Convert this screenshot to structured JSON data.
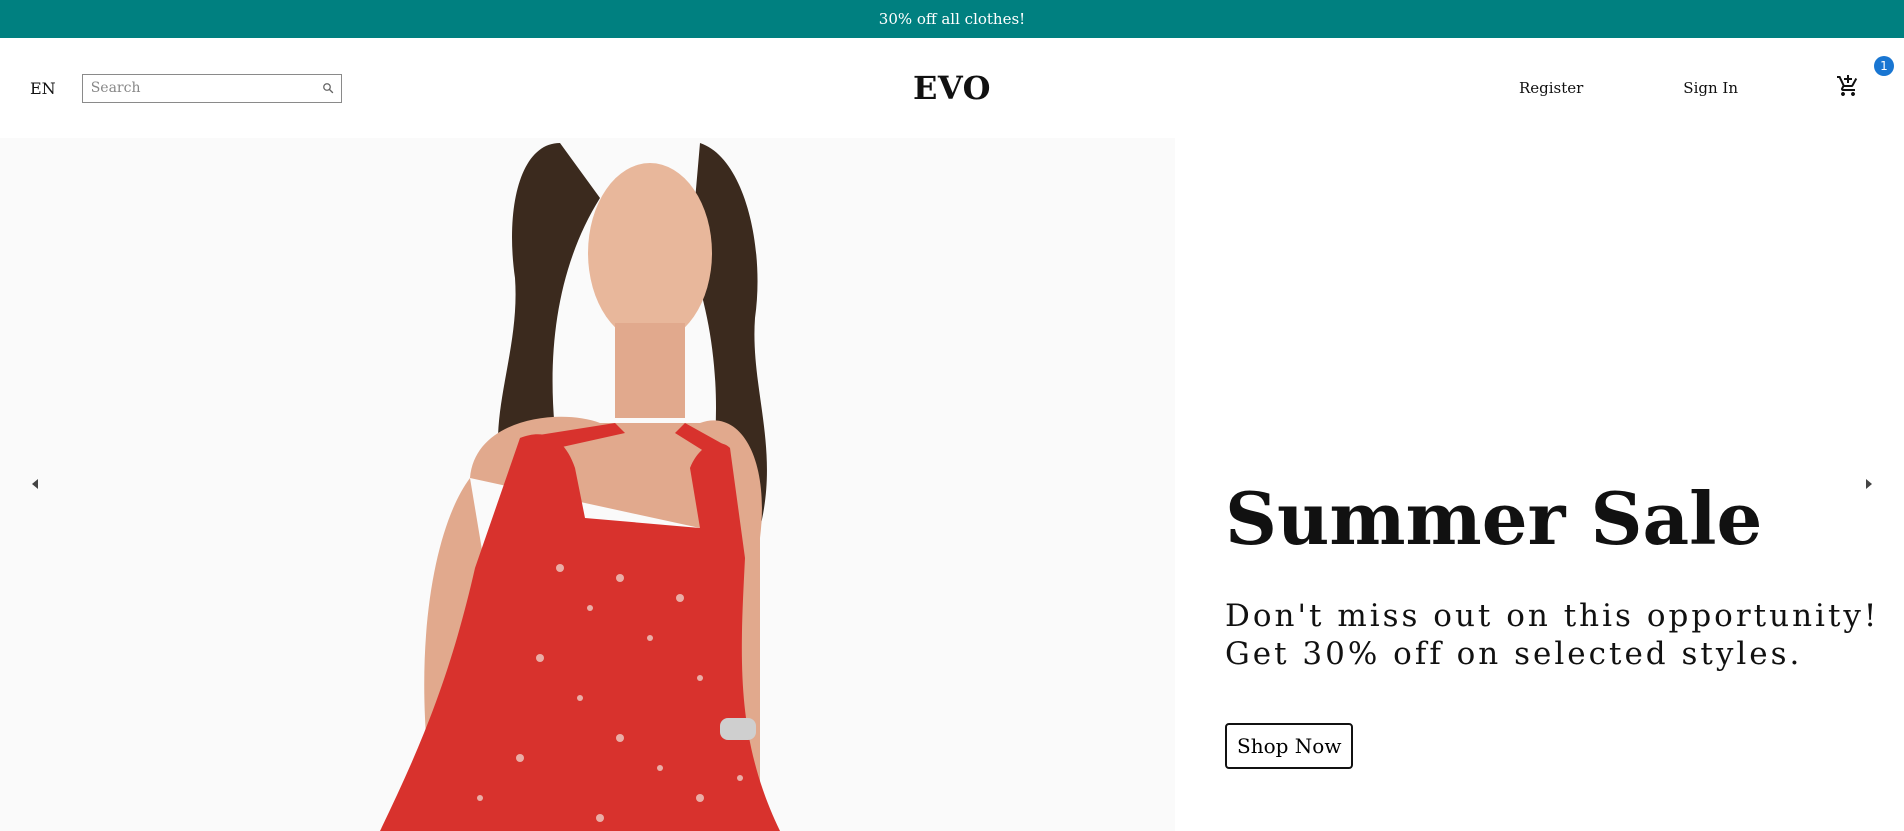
{
  "announcement": {
    "text": "30% off all clothes!"
  },
  "header": {
    "language": "EN",
    "search": {
      "placeholder": "Search",
      "value": ""
    },
    "logo": "EVO",
    "menu": {
      "register": "Register",
      "sign_in": "Sign In"
    },
    "cart": {
      "count": "1"
    }
  },
  "slider": {
    "title": "Summer Sale",
    "description_line1": "Don't miss out on this opportunity!",
    "description_line2": "Get 30% off on selected styles.",
    "button_label": "Shop Now",
    "image_label": "model in red floral halter dress"
  },
  "colors": {
    "announcement_bg": "#008080",
    "badge": "#1976d2",
    "dress": "#d8322d",
    "slide_bg": "#f5f5f5"
  },
  "icons": {
    "search": "search-icon",
    "cart": "shopping-cart-icon",
    "prev": "arrow-left-icon",
    "next": "arrow-right-icon"
  }
}
